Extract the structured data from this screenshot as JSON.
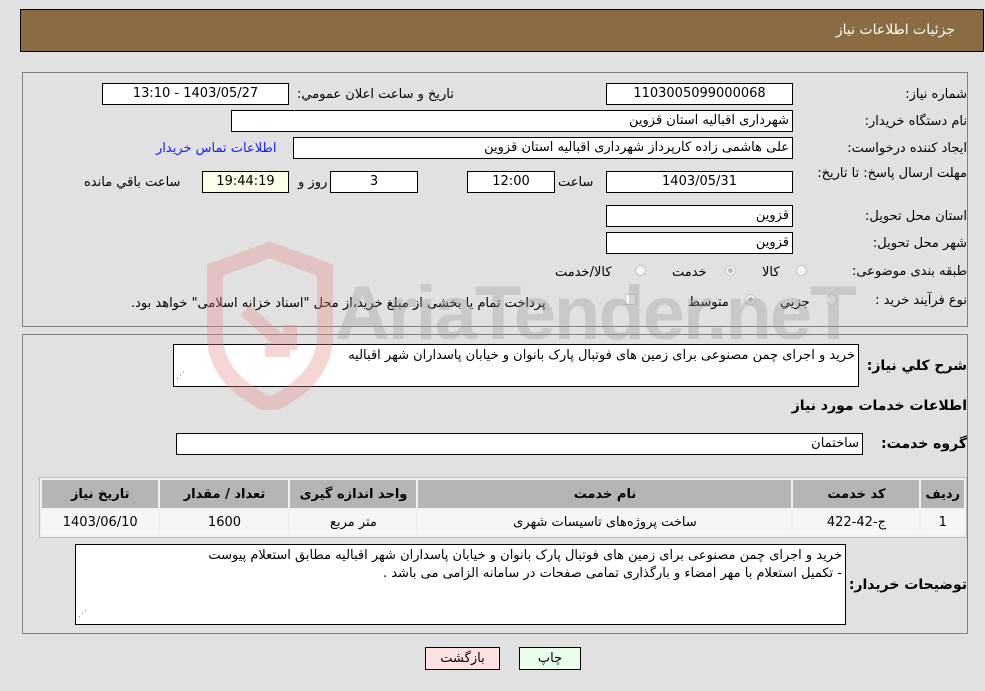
{
  "header": {
    "title": "جزئیات اطلاعات نیاز"
  },
  "form": {
    "need_number": {
      "label": "شماره نیاز:",
      "value": "1103005099000068"
    },
    "announce_datetime": {
      "label": "تاریخ و ساعت اعلان عمومي:",
      "value": "1403/05/27 - 13:10"
    },
    "buyer_org": {
      "label": "نام دستگاه خریدار:",
      "value": "شهرداری اقبالیه استان قزوین"
    },
    "requester": {
      "label": "ایجاد کننده درخواست:",
      "value": "علی هاشمی زاده کارپرداز شهرداری اقبالیه استان قزوین"
    },
    "buyer_contact_link": "اطلاعات تماس خریدار",
    "deadline": {
      "label": "مهلت ارسال پاسخ: تا تاریخ:",
      "date": "1403/05/31",
      "time_label": "ساعت",
      "time": "12:00",
      "days": "3",
      "days_label": "روز و",
      "remaining": "19:44:19",
      "remaining_label": "ساعت باقي مانده"
    },
    "province": {
      "label": "استان محل تحویل:",
      "value": "قزوین"
    },
    "city": {
      "label": "شهر محل تحویل:",
      "value": "قزوین"
    },
    "category": {
      "label": "طبقه بندی موضوعی:",
      "options": [
        "کالا",
        "خدمت",
        "کالا/خدمت"
      ],
      "selected": "خدمت"
    },
    "purchase_type": {
      "label": "نوع فرآیند خرید :",
      "options": [
        "جزيي",
        "متوسط"
      ],
      "selected": "متوسط",
      "treasury_note": "پرداخت تمام یا بخشی از مبلغ خرید،از محل \"اسناد خزانه اسلامی\" خواهد بود."
    }
  },
  "description": {
    "label": "شرح کلي نیاز:",
    "value": "خرید و اجرای چمن مصنوعی برای زمین های فوتبال پارک بانوان و خیابان پاسداران شهر اقبالیه"
  },
  "services": {
    "section_title": "اطلاعات خدمات مورد نیاز",
    "group_label": "گروه خدمت:",
    "group_value": "ساختمان",
    "columns": [
      "ردیف",
      "کد خدمت",
      "نام خدمت",
      "واحد اندازه گیری",
      "تعداد / مقدار",
      "تاریخ نیاز"
    ],
    "rows": [
      [
        "1",
        "ج-42-422",
        "ساخت پروژه‌های تاسیسات شهری",
        "متر مربع",
        "1600",
        "1403/06/10"
      ]
    ]
  },
  "buyer_notes": {
    "label": "توضیحات خریدار:",
    "lines": [
      "خرید و اجرای چمن مصنوعی برای زمین های فوتبال پارک بانوان و خیابان پاسداران شهر اقبالیه مطابق استعلام پیوست",
      "- تکمیل استعلام با مهر امضاء و بارگذاری تمامی صفحات در سامانه الزامی می باشد ."
    ]
  },
  "buttons": {
    "print": "چاپ",
    "back": "بازگشت"
  },
  "watermark": "AriaTender.neT",
  "colors": {
    "header_bg": "#8b6c42",
    "print_btn": "#eaffea",
    "back_btn": "#ffe1e1",
    "link": "#1a1aff"
  }
}
